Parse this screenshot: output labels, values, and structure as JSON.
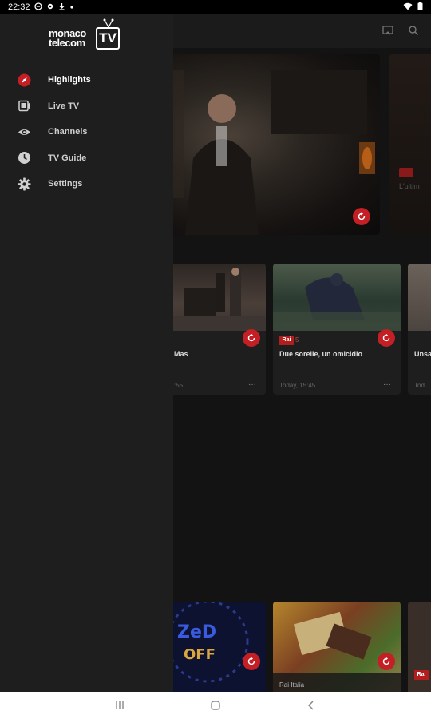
{
  "status_bar": {
    "time": "22:32"
  },
  "drawer": {
    "logo": {
      "line1": "monaco",
      "line2": "telecom",
      "tv": "TV"
    },
    "menu": [
      {
        "label": "Highlights",
        "icon": "compass-icon",
        "active": true
      },
      {
        "label": "Live TV",
        "icon": "live-tv-icon",
        "active": false
      },
      {
        "label": "Channels",
        "icon": "eye-icon",
        "active": false
      },
      {
        "label": "TV Guide",
        "icon": "clock-icon",
        "active": false
      },
      {
        "label": "Settings",
        "icon": "gear-icon",
        "active": false
      }
    ]
  },
  "background": {
    "row1": [
      {
        "title": "Mas",
        "time": ":55"
      },
      {
        "channel_logo": "Rai",
        "channel_name": "5",
        "title": "Due sorelle, un omicidio",
        "time": "Today, 15:45"
      },
      {
        "title": "Unsa",
        "time": "Tod"
      }
    ],
    "hero_side": {
      "logo": "Rai",
      "title": "L'ultim"
    },
    "row2": [
      {
        "title": "Rai Italia",
        "channel_logo": "Rai"
      }
    ]
  },
  "colors": {
    "accent": "#c41f25",
    "drawer_bg": "#1e1e1e",
    "content_bg": "#131313"
  }
}
